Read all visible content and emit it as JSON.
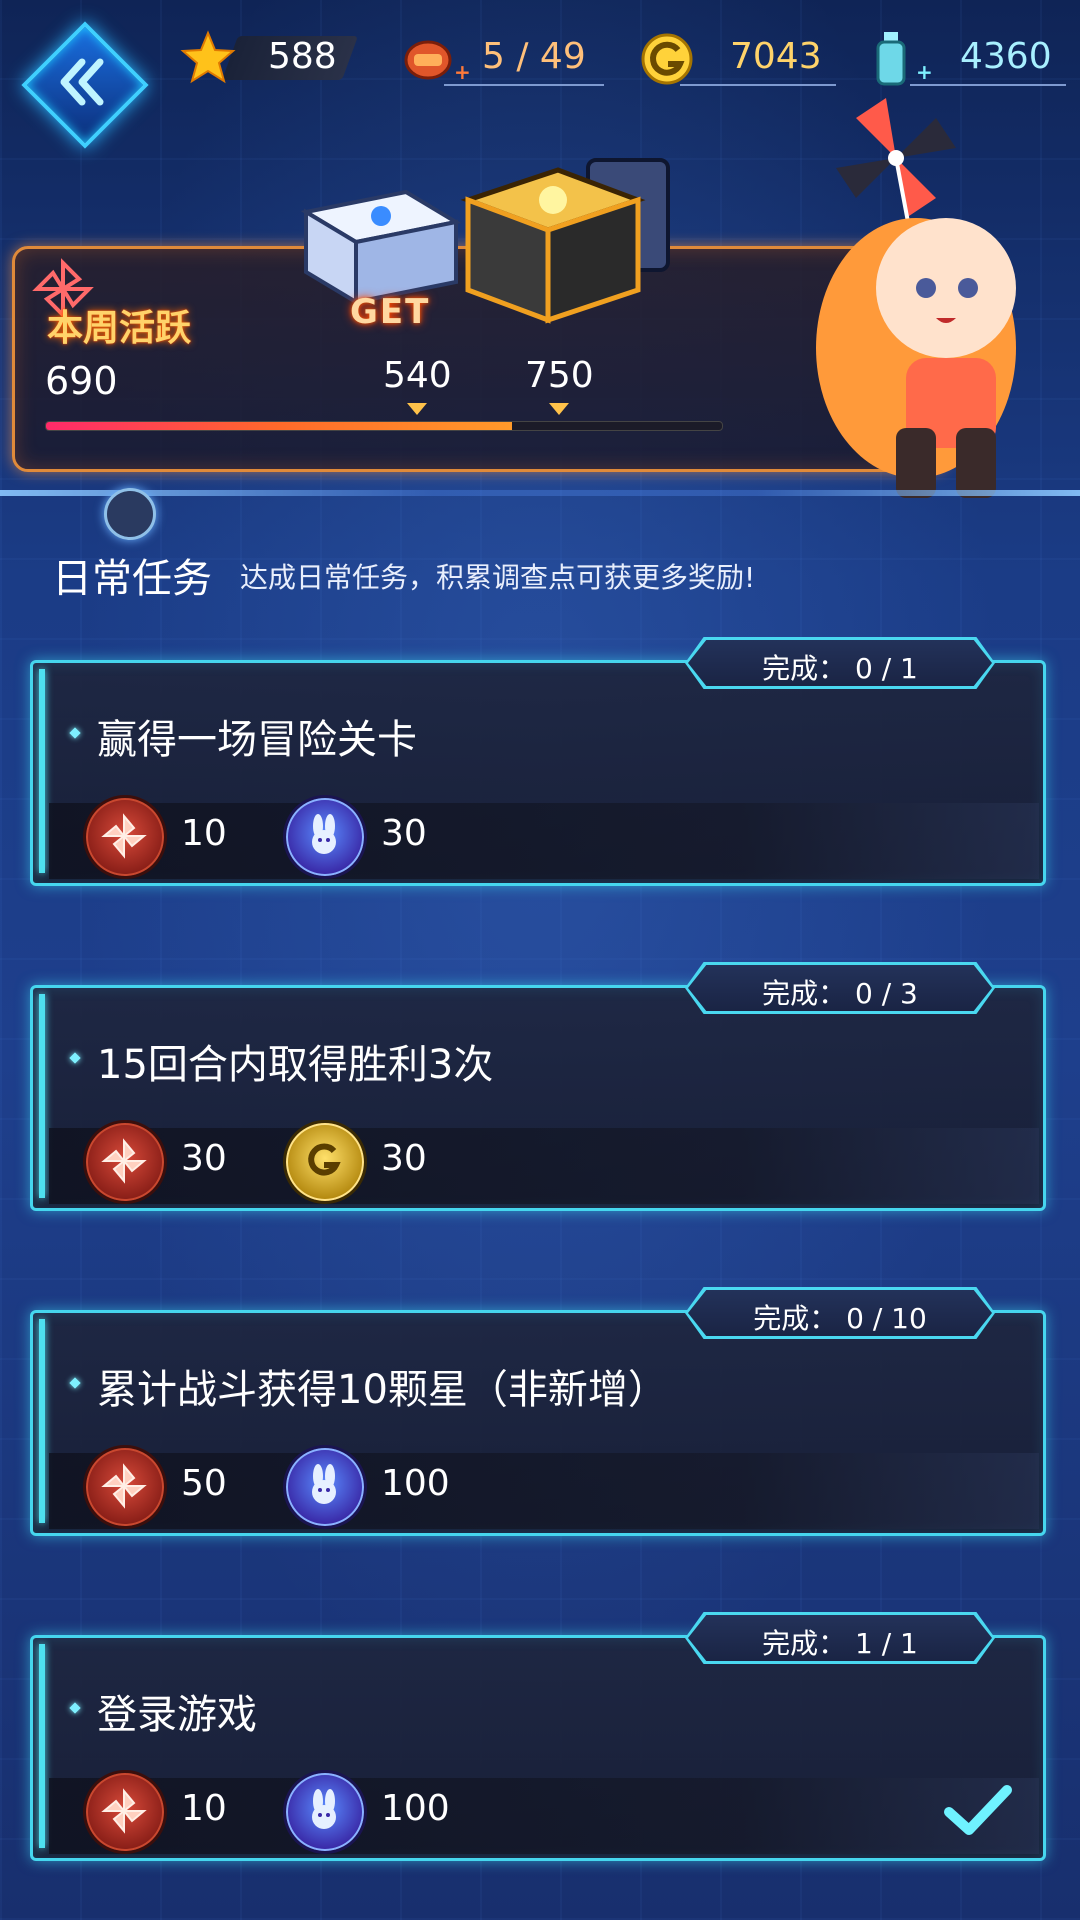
{
  "topbar": {
    "stars": "588",
    "stamina": "5 / 49",
    "gold": "7043",
    "potion": "4360",
    "plus": "+"
  },
  "activity": {
    "title": "本周活跃",
    "value": "690",
    "get_label": "GET",
    "progress_fraction": 0.69,
    "milestones": [
      "540",
      "750"
    ]
  },
  "section": {
    "title": "日常任务",
    "subtitle": "达成日常任务，积累调查点可获更多奖励!"
  },
  "tasks": [
    {
      "title": "赢得一场冒险关卡",
      "progress": "完成： 0 / 1",
      "rewards": [
        {
          "icon": "pinwheel-icon",
          "amount": "10"
        },
        {
          "icon": "rabbit-token-icon",
          "amount": "30"
        }
      ],
      "completed": false
    },
    {
      "title": "15回合内取得胜利3次",
      "progress": "完成： 0 / 3",
      "rewards": [
        {
          "icon": "pinwheel-icon",
          "amount": "30"
        },
        {
          "icon": "gold-coin-icon",
          "amount": "30"
        }
      ],
      "completed": false
    },
    {
      "title": "累计战斗获得10颗星（非新增）",
      "progress": "完成： 0 / 10",
      "rewards": [
        {
          "icon": "pinwheel-icon",
          "amount": "50"
        },
        {
          "icon": "rabbit-token-icon",
          "amount": "100"
        }
      ],
      "completed": false
    },
    {
      "title": "登录游戏",
      "progress": "完成： 1 / 1",
      "rewards": [
        {
          "icon": "pinwheel-icon",
          "amount": "10"
        },
        {
          "icon": "rabbit-token-icon",
          "amount": "100"
        }
      ],
      "completed": true
    }
  ],
  "colors": {
    "accent_cyan": "#46d6ee",
    "activity_orange": "#e08a3a",
    "gold_text": "#ffd36a"
  }
}
